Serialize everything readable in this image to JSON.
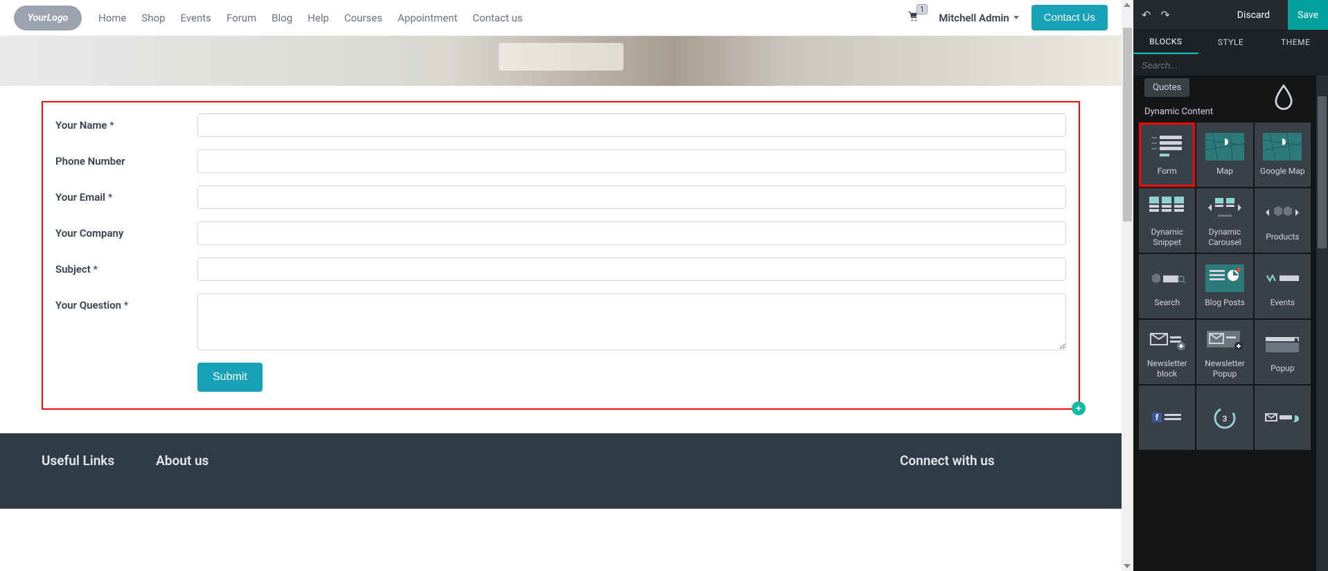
{
  "logo_text": "YourLogo",
  "nav": [
    "Home",
    "Shop",
    "Events",
    "Forum",
    "Blog",
    "Help",
    "Courses",
    "Appointment",
    "Contact us"
  ],
  "cart_count": "1",
  "user_name": "Mitchell Admin",
  "contact_btn": "Contact Us",
  "form": {
    "fields": [
      {
        "label": "Your Name",
        "req": true,
        "type": "text"
      },
      {
        "label": "Phone Number",
        "req": false,
        "type": "text"
      },
      {
        "label": "Your Email",
        "req": true,
        "type": "text"
      },
      {
        "label": "Your Company",
        "req": false,
        "type": "text"
      },
      {
        "label": "Subject",
        "req": true,
        "type": "text"
      },
      {
        "label": "Your Question",
        "req": true,
        "type": "textarea"
      }
    ],
    "submit": "Submit",
    "req_mark": "*"
  },
  "footer": {
    "useful": "Useful Links",
    "about": "About us",
    "connect": "Connect with us"
  },
  "editor": {
    "discard": "Discard",
    "save": "Save",
    "tabs": [
      "BLOCKS",
      "STYLE",
      "THEME"
    ],
    "active_tab": 0,
    "search_placeholder": "Search...",
    "quotes_chip": "Quotes",
    "section_title": "Dynamic Content",
    "blocks": [
      {
        "name": "Form",
        "icon": "form",
        "selected": true
      },
      {
        "name": "Map",
        "icon": "map"
      },
      {
        "name": "Google Map",
        "icon": "gmap"
      },
      {
        "name": "Dynamic Snippet",
        "icon": "dsnip"
      },
      {
        "name": "Dynamic Carousel",
        "icon": "dcar"
      },
      {
        "name": "Products",
        "icon": "prod"
      },
      {
        "name": "Search",
        "icon": "search"
      },
      {
        "name": "Blog Posts",
        "icon": "blog"
      },
      {
        "name": "Events",
        "icon": "events"
      },
      {
        "name": "Newsletter block",
        "icon": "news"
      },
      {
        "name": "Newsletter Popup",
        "icon": "newspop"
      },
      {
        "name": "Popup",
        "icon": "popup"
      },
      {
        "name": "",
        "icon": "fb"
      },
      {
        "name": "",
        "icon": "countdown"
      },
      {
        "name": "",
        "icon": "social"
      }
    ]
  }
}
